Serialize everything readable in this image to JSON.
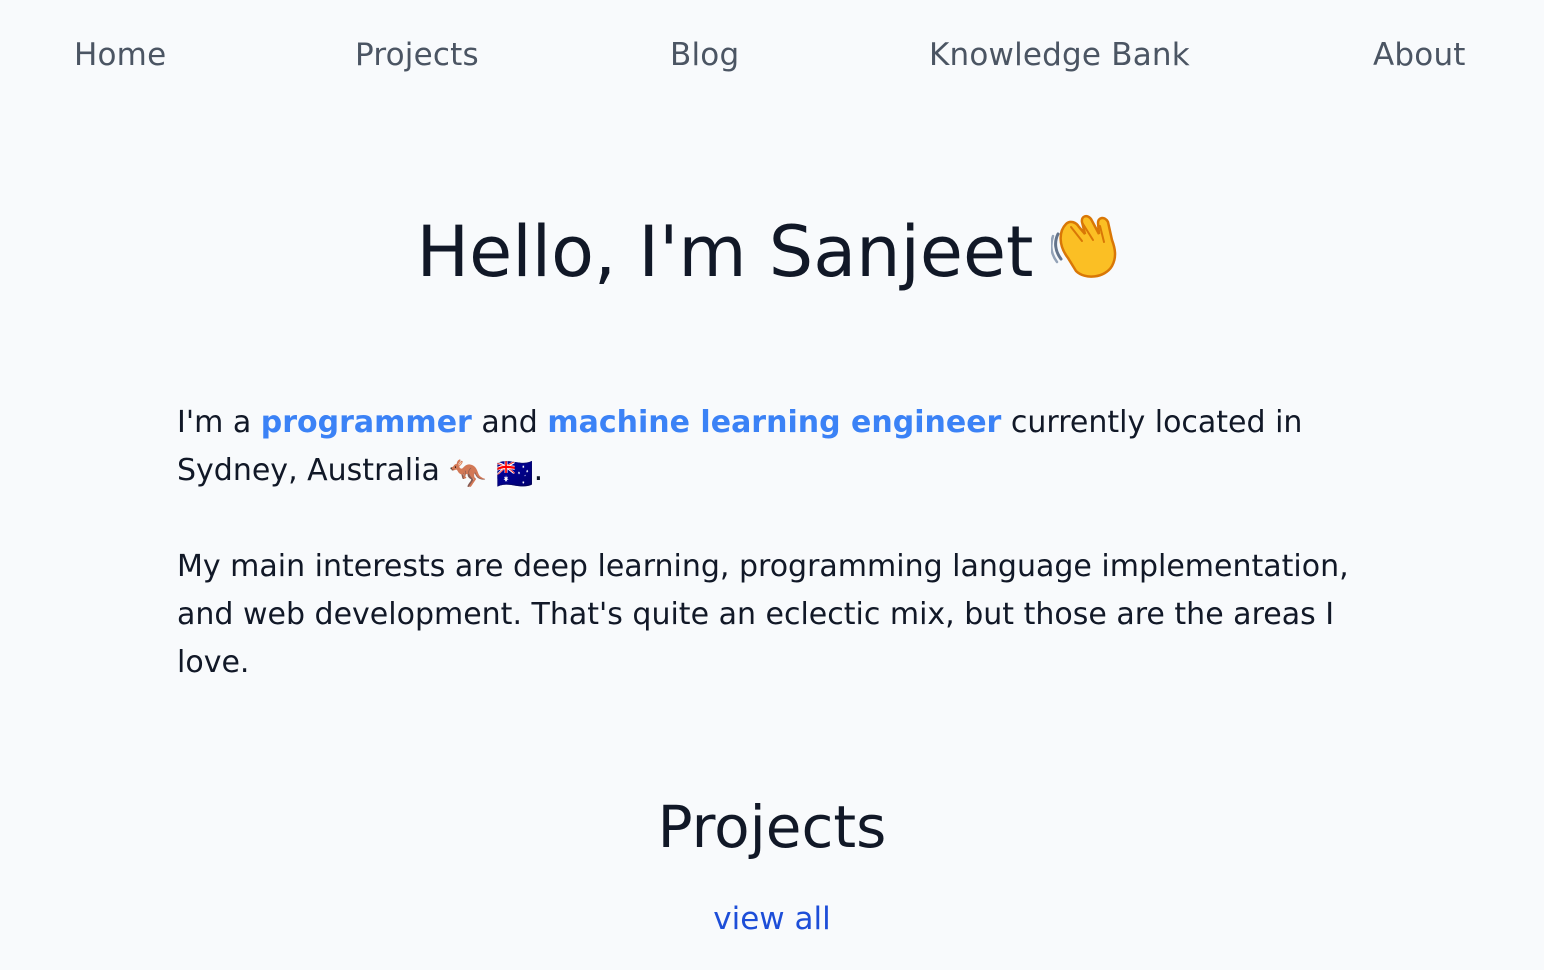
{
  "nav": {
    "home": "Home",
    "projects": "Projects",
    "blog": "Blog",
    "knowledge_bank": "Knowledge Bank",
    "about": "About"
  },
  "hero": {
    "title": "Hello, I'm Sanjeet",
    "emoji": "waving-hand-icon"
  },
  "intro": {
    "p1_prefix": "I'm a ",
    "programmer_link": "programmer",
    "and_text": " and ",
    "ml_link": "machine learning engineer",
    "p1_suffix": " currently located in Sydney, Australia",
    "kangaroo_emoji": "🦘",
    "flag_emoji": "🇦🇺",
    "p1_end": ".",
    "p2": "My main interests are deep learning, programming language implementation, and web development. That's quite an eclectic mix, but those are the areas I love."
  },
  "projects_section": {
    "title": "Projects",
    "view_all": "view all"
  },
  "colors": {
    "background": "#f8fafc",
    "text": "#111827",
    "nav_text": "#4b5563",
    "link_accent": "#3b82f6",
    "view_all_link": "#1d4ed8"
  }
}
